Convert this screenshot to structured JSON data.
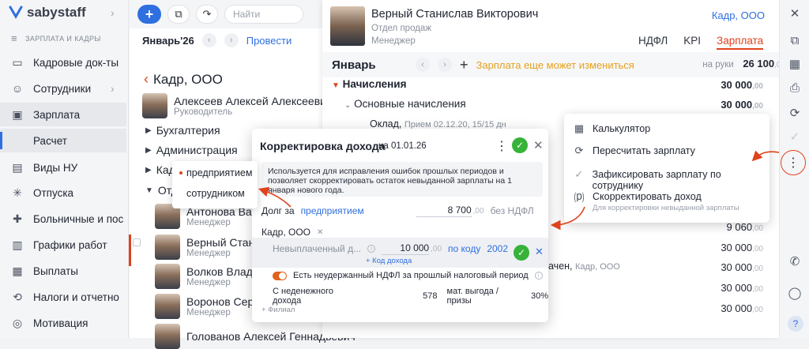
{
  "app": {
    "logo_text": "sabystaff",
    "section": "ЗАРПЛАТА И КАДРЫ"
  },
  "sidebar": {
    "items": [
      {
        "label": "Кадровые док-ты",
        "icon": "documents-icon"
      },
      {
        "label": "Сотрудники",
        "icon": "people-icon"
      },
      {
        "label": "Зарплата",
        "icon": "wallet-icon"
      },
      {
        "label": "Расчет",
        "icon": ""
      },
      {
        "label": "Виды НУ",
        "icon": "inbox-icon"
      },
      {
        "label": "Отпуска",
        "icon": "palm-icon"
      },
      {
        "label": "Больничные и пос",
        "icon": "medical-icon"
      },
      {
        "label": "Графики работ",
        "icon": "chart-icon"
      },
      {
        "label": "Выплаты",
        "icon": "payments-icon"
      },
      {
        "label": "Налоги и отчетно",
        "icon": "taxes-icon"
      },
      {
        "label": "Мотивация",
        "icon": "medal-icon"
      }
    ]
  },
  "topbar": {
    "search_placeholder": "Найти"
  },
  "period": {
    "label": "Январь'26",
    "action": "Провести"
  },
  "list": {
    "org": "Кадр, ООО",
    "head": {
      "name": "Алексеев Алексей Алексеевич",
      "role": "Руководитель"
    },
    "departments": [
      "Бухгалтерия",
      "Администрация",
      "Кадр",
      "Отд"
    ],
    "employees": [
      {
        "name": "Антонова Ванесса",
        "role": "Менеджер"
      },
      {
        "name": "Верный Станислав",
        "role": "Менеджер"
      },
      {
        "name": "Волков Владимир",
        "role": "Менеджер"
      },
      {
        "name": "Воронов Сергей",
        "role": "Менеджер"
      },
      {
        "name": "Голованов Алексей Геннадьевич",
        "role": ""
      }
    ]
  },
  "employee": {
    "name": "Верный Станислав Викторович",
    "dept": "Отдел продаж",
    "role": "Менеджер",
    "org": "Кадр, ООО",
    "tabs": [
      "НДФЛ",
      "KPI",
      "Зарплата"
    ],
    "active_tab": "Зарплата"
  },
  "salary": {
    "month": "Январь",
    "warning": "Зарплата еще может измениться",
    "onhand_label": "на руки",
    "onhand_value": "26 100",
    "onhand_dec": ",00",
    "accruals_label": "Начисления",
    "accruals_value": "30 000",
    "main_label": "Основные начисления",
    "main_value": "30 000",
    "oklad_label": "Оклад,",
    "oklad_note": "Прием 02.12.20, 15/15 дн",
    "row_9060": "9 060",
    "row_30000a": "30 000",
    "row_30000b": "30 000",
    "row_30000c": "30 000",
    "row_30000d": "30 000",
    "row_text": "ачен,",
    "row_text_org": "Кадр, ООО",
    "dec": ",00"
  },
  "context_menu": {
    "items": [
      {
        "label": "Калькулятор",
        "sub": "",
        "icon": "calculator-icon"
      },
      {
        "label": "Пересчитать зарплату",
        "sub": "",
        "icon": "refresh-icon"
      },
      {
        "label": "Зафиксировать зарплату по сотруднику",
        "sub": "",
        "icon": "check-icon"
      },
      {
        "label": "Скорректировать доход",
        "sub": "Для корректировки невыданной зарплаты",
        "icon": "correct-income-icon"
      }
    ]
  },
  "dialog": {
    "title": "Корректировка дохода",
    "date": "на 01.01.26",
    "note": "Используется для исправления ошибок прошлых периодов и позволяет скорректировать остаток невыданной зарплаты на 1 января нового года.",
    "debt_label": "Долг за",
    "debt_link": "предприятием",
    "debt_value": "8 700",
    "debt_dec": ",00",
    "debt_note": "без НДФЛ",
    "org": "Кадр, ООО",
    "unpaid_label": "Невыплаченный д...",
    "unpaid_value": "10 000",
    "unpaid_dec": ",00",
    "by_code": "по коду",
    "code": "2002",
    "add_code": "+ Код дохода",
    "ndfl_toggle": "Есть неудержанный НДФЛ за прошлый налоговый период",
    "income_label": "С неденежного дохода",
    "income_value": "578",
    "benefit": "мат. выгода / призы",
    "pct": "30%",
    "add_branch": "+ Филиал"
  },
  "dropdown": {
    "options": [
      "предприятием",
      "сотрудником"
    ],
    "selected": "предприятием"
  },
  "colors": {
    "accent": "#2f6fe0",
    "brand_red": "#e0421c",
    "warning": "#e6a11c",
    "ok": "#36b338"
  }
}
